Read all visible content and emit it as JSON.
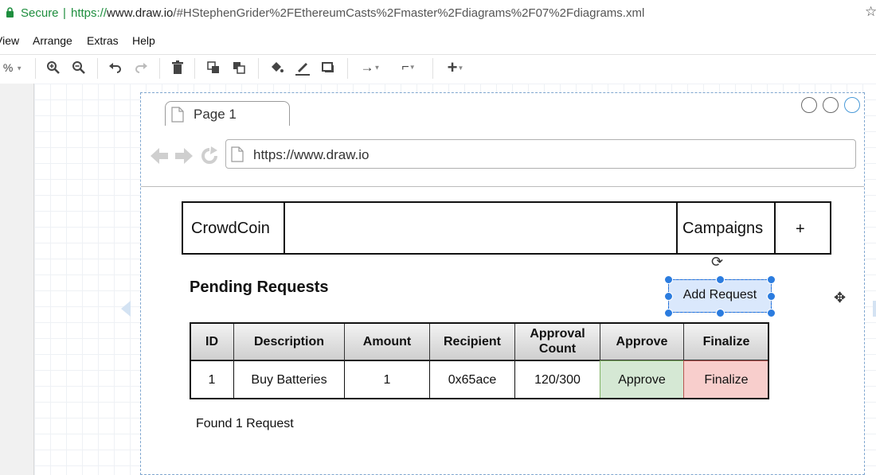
{
  "address_bar": {
    "secure_label": "Secure",
    "separator": "|",
    "url_proto": "https://",
    "url_host": "www.draw.io",
    "url_rest": "/#HStephenGrider%2FEthereumCasts%2Fmaster%2Fdiagrams%2F07%2Fdiagrams.xml",
    "star_icon": "star-icon"
  },
  "menu": [
    "View",
    "Arrange",
    "Extras",
    "Help"
  ],
  "toolbar": {
    "zoom_label": "%",
    "icons": [
      "zoom-in-icon",
      "zoom-out-icon",
      "undo-icon",
      "redo-icon",
      "delete-icon",
      "to-front-icon",
      "to-back-icon",
      "fill-color-icon",
      "line-color-icon",
      "shadow-icon",
      "connection-icon",
      "waypoints-icon",
      "insert-icon"
    ]
  },
  "mockup": {
    "tab_label": "Page 1",
    "url": "https://www.draw.io"
  },
  "app": {
    "brand": "CrowdCoin",
    "nav_campaigns": "Campaigns",
    "nav_plus": "+",
    "section_title": "Pending Requests",
    "add_request": "Add Request",
    "found_text": "Found 1 Request"
  },
  "table": {
    "headers": [
      "ID",
      "Description",
      "Amount",
      "Recipient",
      "Approval\nCount",
      "Approve",
      "Finalize"
    ],
    "rows": [
      [
        "1",
        "Buy Batteries",
        "1",
        "0x65ace",
        "120/300",
        "Approve",
        "Finalize"
      ]
    ]
  },
  "colors": {
    "secure_green": "#1e8e3e",
    "selection_blue": "#2b7cdf",
    "approve_fill": "#d5e8d4",
    "finalize_fill": "#f8cecc",
    "add_request_fill": "#dae8fc"
  }
}
